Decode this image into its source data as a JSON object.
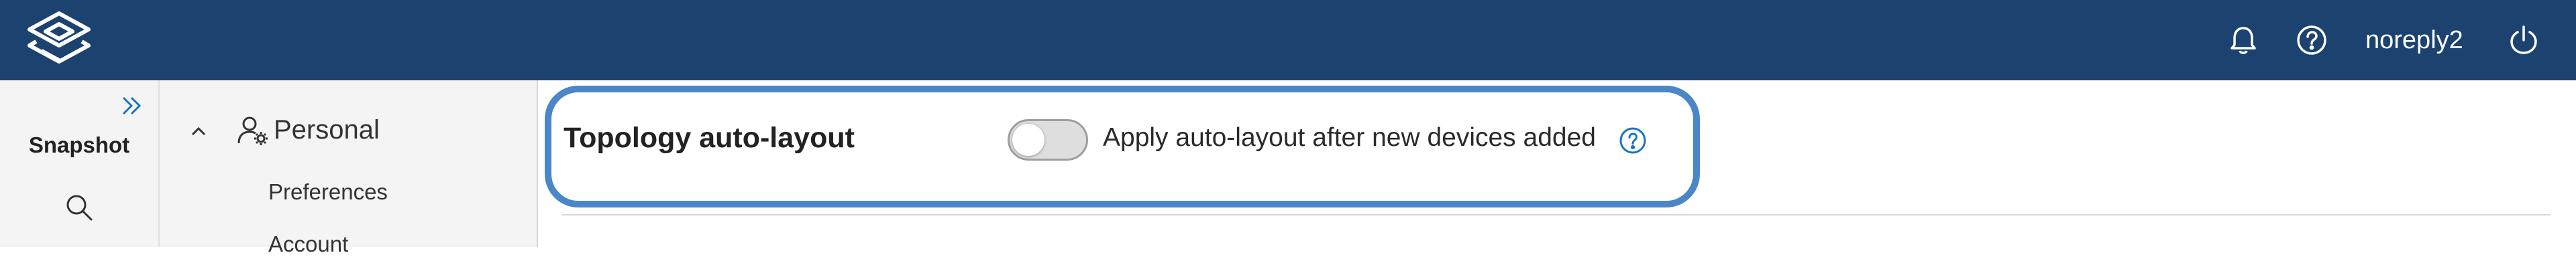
{
  "colors": {
    "brand": "#1c426f",
    "accent": "#1a73c4",
    "highlight": "#4a86c8"
  },
  "header": {
    "logo_icon": "layered-diamond-logo",
    "icons": [
      "bell-icon",
      "help-circle-icon",
      "power-icon"
    ],
    "username": "noreply2"
  },
  "rail": {
    "expand_icon": "double-chevron-right-icon",
    "title": "Snapshot",
    "search_icon": "search-icon"
  },
  "nav": {
    "section": {
      "label": "Personal",
      "expanded": true,
      "icon": "user-settings-icon"
    },
    "items": [
      {
        "label": "Preferences"
      },
      {
        "label": "Account"
      }
    ]
  },
  "main": {
    "setting": {
      "title": "Topology auto-layout",
      "toggle_on": false,
      "toggle_label": "Apply auto-layout after new devices added",
      "help_icon": "help-circle-icon"
    }
  }
}
